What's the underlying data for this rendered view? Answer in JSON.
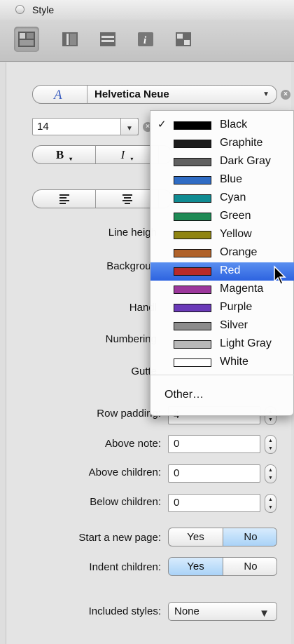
{
  "window": {
    "title": "Style"
  },
  "toolbar": {
    "icons": [
      "style-inspector-icon",
      "columns-inspector-icon",
      "rows-inspector-icon",
      "info-inspector-icon",
      "layout-inspector-icon"
    ]
  },
  "font": {
    "name": "Helvetica Neue",
    "size": "14",
    "bold_label": "B",
    "italic_label": "I"
  },
  "labels": {
    "line_height": "Line heigh",
    "background": "Backgroun",
    "handle": "Handl",
    "numbering": "Numbering",
    "gutter": "Gutte",
    "row_padding": "Row padding:",
    "above_note": "Above note:",
    "above_children": "Above children:",
    "below_children": "Below children:",
    "start_new_page": "Start a new page:",
    "indent_children": "Indent children:",
    "included_styles": "Included styles:"
  },
  "values": {
    "row_padding": "4",
    "above_note": "0",
    "above_children": "0",
    "below_children": "0",
    "included_styles": "None"
  },
  "toggles": {
    "start_new_page": {
      "yes": "Yes",
      "no": "No",
      "selected": "No"
    },
    "indent_children": {
      "yes": "Yes",
      "no": "No",
      "selected": "Yes"
    }
  },
  "color_menu": {
    "items": [
      {
        "name": "Black",
        "color": "#000000",
        "checked": true
      },
      {
        "name": "Graphite",
        "color": "#1c1c1c"
      },
      {
        "name": "Dark Gray",
        "color": "#606060"
      },
      {
        "name": "Blue",
        "color": "#2f6cc4"
      },
      {
        "name": "Cyan",
        "color": "#0f8b92"
      },
      {
        "name": "Green",
        "color": "#1e8a55"
      },
      {
        "name": "Yellow",
        "color": "#8f8412"
      },
      {
        "name": "Orange",
        "color": "#b0622a"
      },
      {
        "name": "Red",
        "color": "#b82a2a",
        "highlighted": true
      },
      {
        "name": "Magenta",
        "color": "#9c379c"
      },
      {
        "name": "Purple",
        "color": "#6a3ab8"
      },
      {
        "name": "Silver",
        "color": "#8c8c8c"
      },
      {
        "name": "Light Gray",
        "color": "#b8b8b8"
      },
      {
        "name": "White",
        "color": "#ffffff"
      }
    ],
    "other": "Other…",
    "check": "✓"
  }
}
